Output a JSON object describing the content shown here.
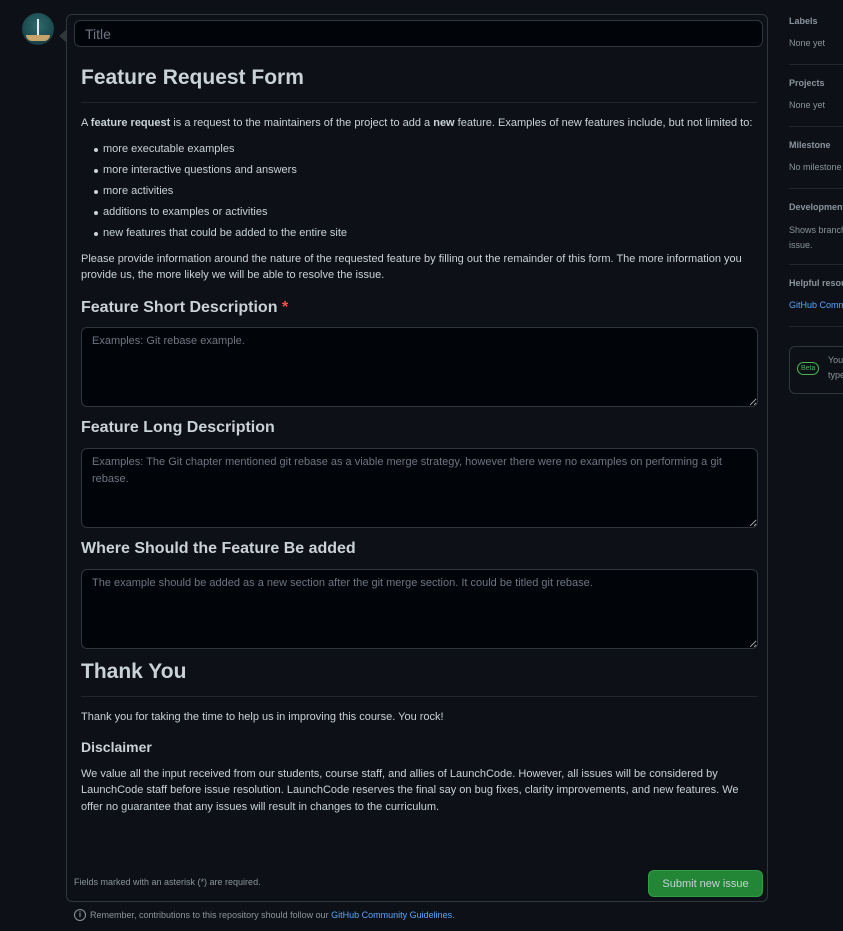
{
  "title_input": {
    "placeholder": "Title",
    "value": ""
  },
  "form": {
    "heading": "Feature Request Form",
    "intro": {
      "a": "A ",
      "b1": "feature request",
      "mid": " is a request to the maintainers of the project to add a ",
      "b2": "new",
      "end": " feature. Examples of new features include, but not limited to:"
    },
    "features": [
      "more executable examples",
      "more interactive questions and answers",
      "more activities",
      "additions to examples or activities",
      "new features that could be added to the entire site"
    ],
    "info": "Please provide information around the nature of the requested feature by filling out the remainder of this form. The more information you provide us, the more likely we will be able to resolve the issue.",
    "fields": [
      {
        "label": "Feature Short Description",
        "required": "*",
        "placeholder": "Examples: Git rebase example."
      },
      {
        "label": "Feature Long Description",
        "placeholder": "Examples: The Git chapter mentioned git rebase as a viable merge strategy, however there were no examples on performing a git rebase."
      },
      {
        "label": "Where Should the Feature Be added",
        "placeholder": "The example should be added as a new section after the git merge section. It could be titled git rebase."
      }
    ],
    "thanks_heading": "Thank You",
    "thanks_text": "Thank you for taking the time to help us in improving this course. You rock!",
    "disclaimer_heading": "Disclaimer",
    "disclaimer_text": "We value all the input received from our students, course staff, and allies of LaunchCode. However, all issues will be considered by LaunchCode staff before issue resolution. LaunchCode reserves the final say on bug fixes, clarity improvements, and new features. We offer no guarantee that any issues will result in changes to the curriculum.",
    "required_note": "Fields marked with an asterisk (*) are required.",
    "submit_label": "Submit new issue"
  },
  "guidelines": {
    "text": "Remember, contributions to this repository should follow our ",
    "link": "GitHub Community Guidelines",
    "end": "."
  },
  "sidebar": {
    "labels": {
      "heading": "Labels",
      "value": "None yet"
    },
    "projects": {
      "heading": "Projects",
      "value": "None yet"
    },
    "milestone": {
      "heading": "Milestone",
      "value": "No milestone"
    },
    "development": {
      "heading": "Development",
      "value_1": "Shows branches",
      "value_2": "issue."
    },
    "helpful": {
      "heading": "Helpful resources",
      "link": "GitHub Community"
    },
    "beta": {
      "badge": "Beta",
      "line_1": "You",
      "line_2": "type"
    }
  },
  "icons": {
    "info": "info-circle-icon",
    "avatar": "avatar-sailboat"
  },
  "colors": {
    "background": "#0d1117",
    "submit": "#238636",
    "link": "#58a6ff",
    "required": "#f85149",
    "beta": "#3fb950"
  }
}
